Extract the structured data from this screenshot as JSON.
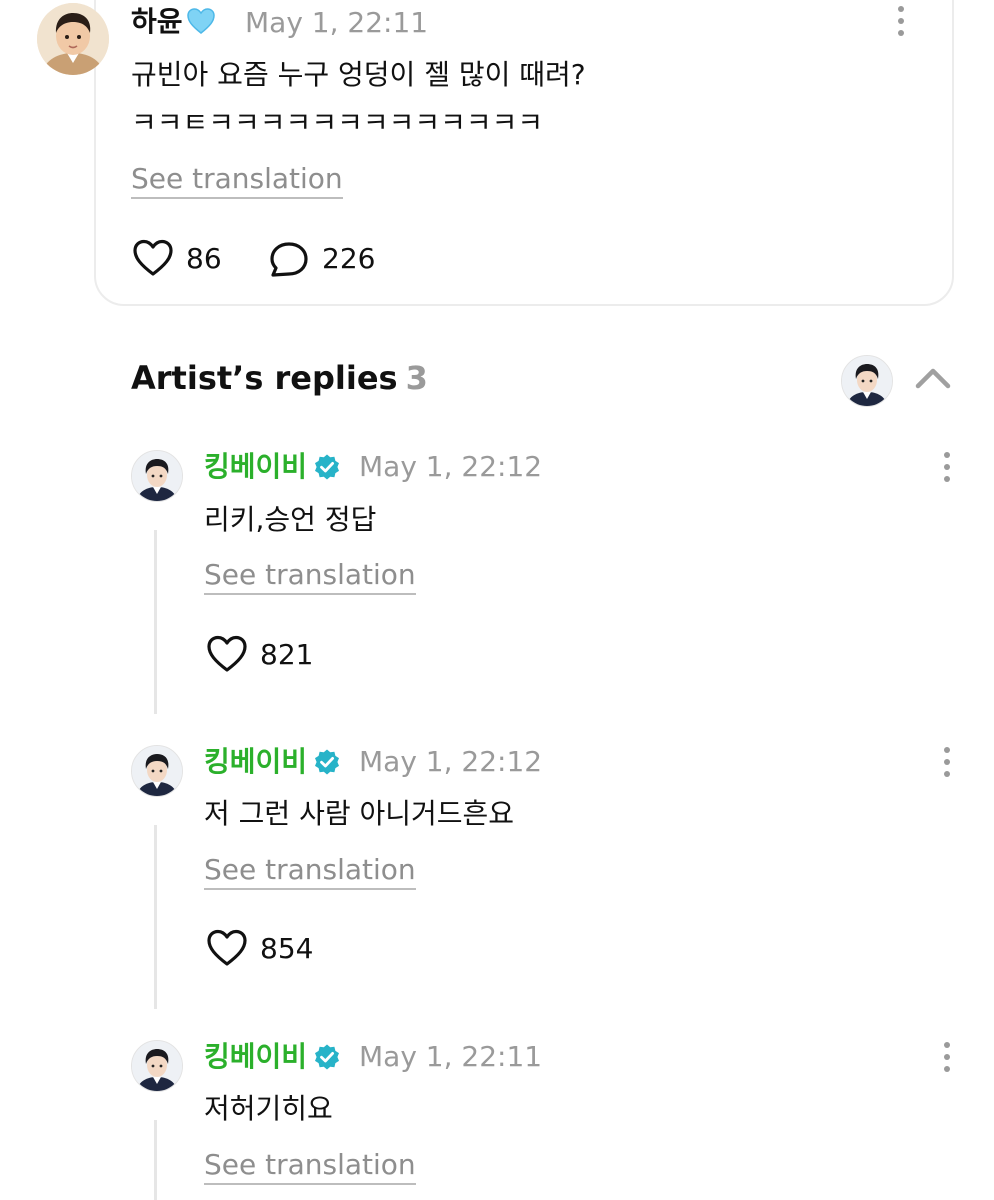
{
  "post": {
    "author": "하윤",
    "time": "May 1, 22:11",
    "text_line1": "규빈아 요즘 누구 엉덩이 젤 많이 때려?",
    "text_line2": "ㅋㅋㅌㅋㅋㅋㅋㅋㅋㅋㅋㅋㅋㅋㅋㅋ",
    "see_translation": "See translation",
    "likes": "86",
    "comments": "226",
    "icons": {
      "author_badge": "blue-heart-icon",
      "like": "heart-icon",
      "comment": "comment-bubble-icon",
      "menu": "more-vertical-icon"
    }
  },
  "replies_section": {
    "title": "Artist’s replies",
    "count": "3",
    "icons": {
      "collapse": "chevron-up-icon"
    }
  },
  "replies": [
    {
      "author": "킹베이비",
      "time": "May 1, 22:12",
      "text": "리키,승언 정답",
      "see_translation": "See translation",
      "likes": "821"
    },
    {
      "author": "킹베이비",
      "time": "May 1, 22:12",
      "text": "저 그런 사람 아니거드흔요",
      "see_translation": "See translation",
      "likes": "854"
    },
    {
      "author": "킹베이비",
      "time": "May 1, 22:11",
      "text": "저허기히요",
      "see_translation": "See translation"
    }
  ],
  "colors": {
    "artist_name": "#2bb02b",
    "verified_badge": "#27b3c8",
    "muted_text": "#9a9a9a"
  }
}
